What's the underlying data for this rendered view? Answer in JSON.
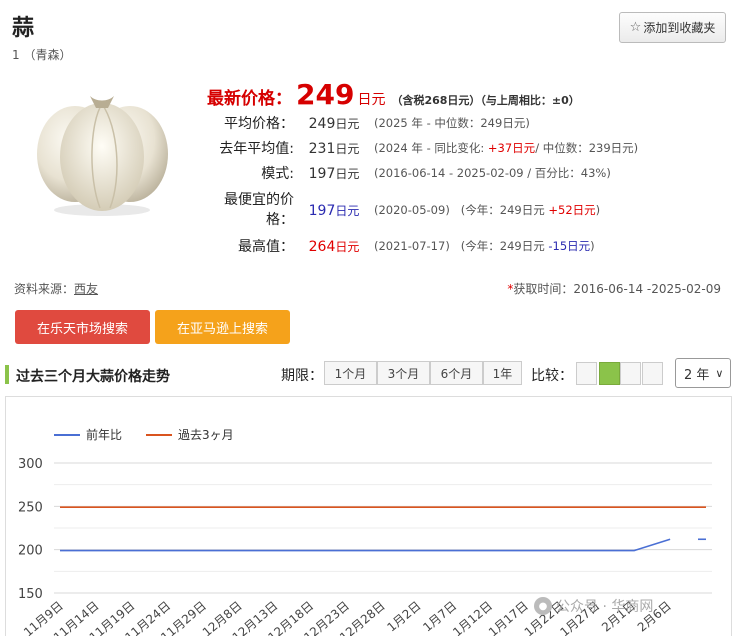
{
  "product": {
    "title": "蒜",
    "subtitle": "1 （青森）"
  },
  "favorite": {
    "icon": "star-outline-icon",
    "label": "添加到收藏夹"
  },
  "latest": {
    "label": "最新价格：",
    "value": "249",
    "unit": "日元",
    "extra": "（含税268日元）（与上周相比：±0）"
  },
  "stats": [
    {
      "label": "平均价格：",
      "value": "249",
      "unit": "日元",
      "note": "(2025 年 - 中位数：249日元)"
    },
    {
      "label": "去年平均值:",
      "value": "231",
      "unit": "日元",
      "note_a": "(2024 年 - 同比变化: ",
      "note_b": "+37日元",
      "note_c": "/ 中位数：239日元)"
    },
    {
      "label": "模式:",
      "value": "197",
      "unit": "日元",
      "note": "(2016-06-14 - 2025-02-09 / 百分比：43%)"
    },
    {
      "label_a": "最便宜的价",
      "label_b": "格：",
      "value": "197",
      "unit": "日元",
      "note_a": "(2020-05-09)",
      "note_b": "(今年：249日元 ",
      "note_c": "+52日元",
      "note_d": ")"
    },
    {
      "label": "最高值：",
      "value": "264",
      "unit": "日元",
      "note_a": "(2021-07-17)",
      "note_b": "(今年：249日元 ",
      "note_c": "-15日元",
      "note_d": ")"
    }
  ],
  "source": {
    "label": "资料来源：",
    "link": "西友"
  },
  "fetch": {
    "asterisk": "*",
    "text": "获取时间：2016-06-14 -2025-02-09"
  },
  "buttons": {
    "rakuten": "在乐天市场搜索",
    "amazon": "在亚马逊上搜索"
  },
  "section": {
    "title": "过去三个月大蒜价格走势"
  },
  "period": {
    "label": "期限：",
    "options": [
      "1个月",
      "3个月",
      "6个月",
      "1年"
    ]
  },
  "compare": {
    "label": "比较："
  },
  "select": {
    "value": "2 年"
  },
  "watermark": {
    "text": "公众号 · 华商网"
  },
  "colors": {
    "accent_red": "#d60000",
    "last_year": "#4a6fd4",
    "past3": "#d9541f",
    "compare_on": "#8bc34a"
  },
  "chart_data": {
    "type": "line",
    "legend": [
      "前年比",
      "過去3ヶ月"
    ],
    "y_ticks": [
      "300",
      "250",
      "200",
      "150"
    ],
    "ylim": [
      150,
      300
    ],
    "x_ticks": [
      "11月9日",
      "11月14日",
      "11月19日",
      "11月24日",
      "11月29日",
      "12月8日",
      "12月13日",
      "12月18日",
      "12月23日",
      "12月28日",
      "1月2日",
      "1月7日",
      "1月12日",
      "1月17日",
      "1月22日",
      "1月27日",
      "2月1日",
      "2月6日"
    ],
    "series": [
      {
        "name": "前年比",
        "color": "#4a6fd4",
        "values": [
          199,
          199,
          199,
          199,
          199,
          199,
          199,
          199,
          199,
          199,
          199,
          199,
          199,
          199,
          199,
          199,
          199,
          212,
          212
        ]
      },
      {
        "name": "過去3ヶ月",
        "color": "#d9541f",
        "values": [
          249,
          249,
          249,
          249,
          249,
          249,
          249,
          249,
          249,
          249,
          249,
          249,
          249,
          249,
          249,
          249,
          249,
          249,
          249
        ]
      }
    ]
  }
}
